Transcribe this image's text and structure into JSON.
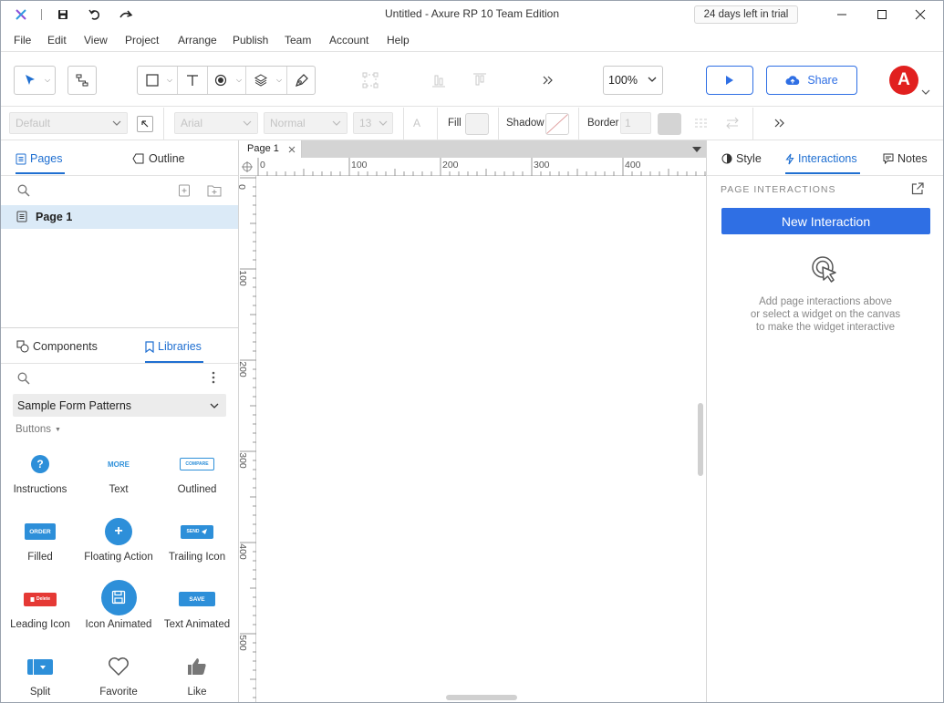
{
  "window": {
    "title": "Untitled - Axure RP 10 Team Edition",
    "trial": "24 days left in trial"
  },
  "menu": [
    "File",
    "Edit",
    "View",
    "Project",
    "Arrange",
    "Publish",
    "Team",
    "Account",
    "Help"
  ],
  "toolbar": {
    "zoom": "100%",
    "share_label": "Share",
    "avatar_letter": "A"
  },
  "styletb": {
    "style_placeholder": "Default",
    "font_family": "Arial",
    "font_weight": "Normal",
    "font_size": "13",
    "fill_label": "Fill",
    "shadow_label": "Shadow",
    "border_label": "Border",
    "border_value": "1"
  },
  "left": {
    "tabs": {
      "pages": "Pages",
      "outline": "Outline"
    },
    "pages": [
      {
        "name": "Page 1"
      }
    ],
    "bottom_tabs": {
      "components": "Components",
      "libraries": "Libraries"
    },
    "library_select": "Sample Form Patterns",
    "section": "Buttons",
    "items": [
      {
        "label": "Instructions",
        "mark": "?"
      },
      {
        "label": "Text",
        "mark": "MORE"
      },
      {
        "label": "Outlined",
        "mark": "COMPARE"
      },
      {
        "label": "Filled",
        "mark": "ORDER"
      },
      {
        "label": "Floating Action",
        "mark": "+"
      },
      {
        "label": "Trailing Icon",
        "mark": "SEND"
      },
      {
        "label": "Leading Icon",
        "mark": "Delete"
      },
      {
        "label": "Icon Animated",
        "mark": ""
      },
      {
        "label": "Text Animated",
        "mark": "SAVE"
      },
      {
        "label": "Split",
        "mark": ""
      },
      {
        "label": "Favorite",
        "mark": ""
      },
      {
        "label": "Like",
        "mark": ""
      }
    ]
  },
  "canvas": {
    "tab": "Page 1",
    "ruler_x": [
      "0",
      "100",
      "200",
      "300",
      "400"
    ],
    "ruler_y": [
      "0",
      "100",
      "200",
      "300",
      "400",
      "500"
    ]
  },
  "right": {
    "tabs": {
      "style": "Style",
      "interactions": "Interactions",
      "notes": "Notes"
    },
    "section": "PAGE INTERACTIONS",
    "new_btn": "New Interaction",
    "hint": [
      "Add page interactions above",
      "or select a widget on the canvas",
      "to make the widget interactive"
    ]
  },
  "colors": {
    "accent": "#1f6fd1",
    "btn_blue": "#2f6fe4",
    "lib_blue": "#2d8fd9",
    "avatar": "#e1201f",
    "delete_red": "#e53935"
  }
}
